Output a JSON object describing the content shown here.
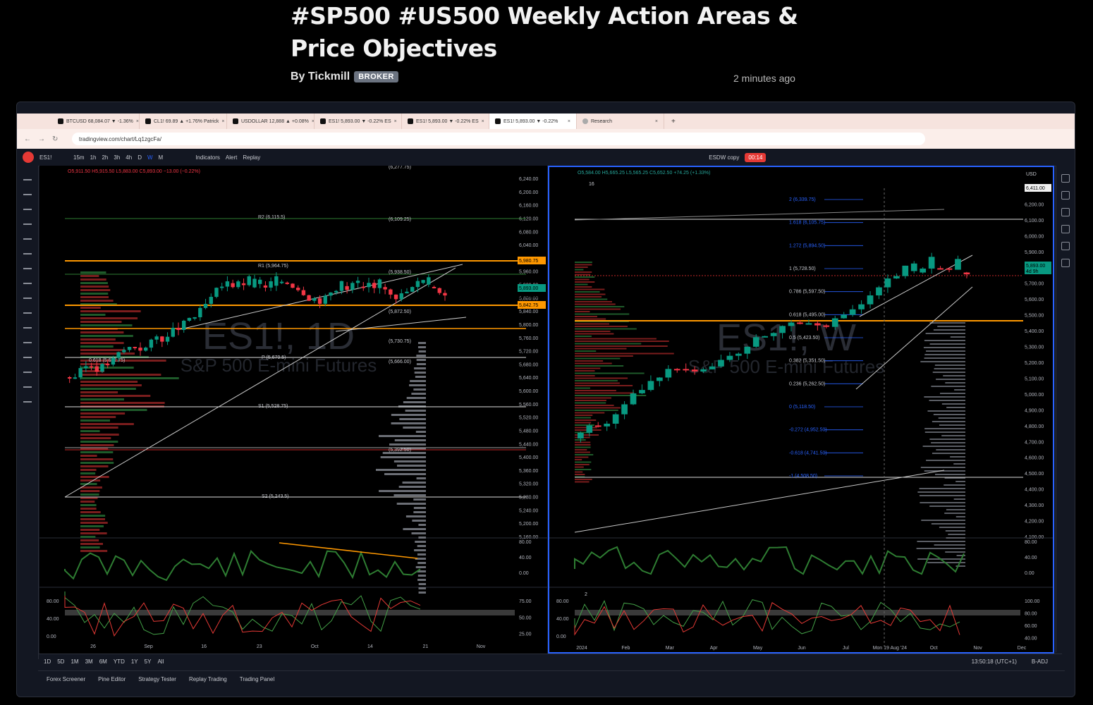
{
  "article": {
    "title": "#SP500 #US500 Weekly Action Areas & Price Objectives",
    "author": "By Tickmill",
    "badge": "BROKER",
    "time_ago": "2 minutes ago"
  },
  "browser": {
    "tabs": [
      {
        "label": "BTCUSD 68,084.07 ▼ -1.36%"
      },
      {
        "label": "CL1! 69.89 ▲ +1.76% Patrick"
      },
      {
        "label": "USDOLLAR 12,888 ▲ +0.08%"
      },
      {
        "label": "ES1! 5,893.00 ▼ -0.22% ES"
      },
      {
        "label": "ES1! 5,893.00 ▼ -0.22% ES"
      },
      {
        "label": "ES1! 5,893.00 ▼ -0.22%"
      },
      {
        "label": "Research"
      }
    ],
    "url": "tradingview.com/chart/Lq1zgcFa/"
  },
  "toolbar": {
    "symbol": "ES1!",
    "intervals": [
      "15m",
      "1h",
      "2h",
      "3h",
      "4h",
      "D",
      "W",
      "M"
    ],
    "indicators": "Indicators",
    "alert": "Alert",
    "replay": "Replay",
    "layout": "ESDW copy",
    "rec_time": "00:14"
  },
  "left_chart": {
    "ohlc": {
      "o": "O5,911.50",
      "h": "H5,915.50",
      "l": "L5,883.00",
      "c": "C5,893.00",
      "chg": "−13.00 (−0.22%)"
    },
    "watermark": "ES1!, 1D",
    "watermark_sub": "S&P 500 E-mini Futures",
    "price_ticks": [
      "6,240.00",
      "6,200.00",
      "6,160.00",
      "6,120.00",
      "6,080.00",
      "6,040.00",
      "6,000.00",
      "5,960.00",
      "5,920.00",
      "5,880.00",
      "5,840.00",
      "5,800.00",
      "5,760.00",
      "5,720.00",
      "5,680.00",
      "5,640.00",
      "5,600.00",
      "5,560.00",
      "5,520.00",
      "5,480.00",
      "5,440.00",
      "5,400.00",
      "5,360.00",
      "5,320.00",
      "5,280.00",
      "5,240.00",
      "5,200.00",
      "5,160.00"
    ],
    "time_ticks": [
      "26",
      "Sep",
      "16",
      "23",
      "Oct",
      "14",
      "21",
      "Nov"
    ],
    "labels": {
      "r2": "R2 (6,115.5)",
      "r1": "R1 (5,964.75)",
      "p": "P (5,679.5)",
      "s1": "S1 (5,528.75)",
      "s2": "S2 (5,243.5)",
      "lvl_top": "(6,277.75)",
      "lvl_6109": "(6,109.25)",
      "lvl_5938": "(5,938.50)",
      "lvl_5872": "(5,872.50)",
      "lvl_5730": "(5,730.75)",
      "lvl_5666": "(5,666.00)",
      "lvl_5392": "(5,392.50)",
      "poc": "0.618 (5,672.75)"
    },
    "price_tags": {
      "upper": "5,980.75",
      "last": "5,893.00",
      "last_time": "08:09:40",
      "lower": "5,842.75"
    },
    "rsi_ticks": [
      "80.00",
      "40.00",
      "0.00"
    ],
    "stoch_ticks": [
      "80.00",
      "40.00",
      "0.00"
    ],
    "stoch_right": [
      "75.00",
      "50.00",
      "25.00"
    ]
  },
  "right_chart": {
    "ohlc": {
      "o": "O5,584.00",
      "h": "H5,665.25",
      "l": "L5,565.25",
      "c": "C5,652.50",
      "chg": "+74.25 (+1.33%)"
    },
    "lookback": "16",
    "watermark": "ES1!, W",
    "watermark_sub": "S&P 500 E-mini Futures",
    "price_ticks": [
      "6,300.00",
      "6,200.00",
      "6,100.00",
      "6,000.00",
      "5,900.00",
      "5,800.00",
      "5,700.00",
      "5,600.00",
      "5,500.00",
      "5,400.00",
      "5,300.00",
      "5,200.00",
      "5,100.00",
      "5,000.00",
      "4,900.00",
      "4,800.00",
      "4,700.00",
      "4,600.00",
      "4,500.00",
      "4,400.00",
      "4,300.00",
      "4,200.00",
      "4,100.00"
    ],
    "time_ticks": [
      "2024",
      "Feb",
      "Mar",
      "Apr",
      "May",
      "Jun",
      "Jul",
      "Mon 19 Aug '24",
      "Oct",
      "Nov",
      "Dec"
    ],
    "fib": [
      "2 (6,339.75)",
      "1.618 (6,105.75)",
      "1.272 (5,894.50)",
      "1 (5,728.50)",
      "0.786 (5,597.50)",
      "0.618 (5,495.00)",
      "0.5 (5,423.50)",
      "0.382 (5,351.50)",
      "0.236 (5,262.50)",
      "0 (5,118.50)",
      "-0.272 (4,952.50)",
      "-0.618 (4,741.50)",
      "-1 (4,508.50)"
    ],
    "price_tags": {
      "top": "6,411.00",
      "last": "5,893.00",
      "last_time": "4d 9h"
    },
    "currency": "USD",
    "rsi_ticks": [
      "80.00",
      "40.00",
      "0.00"
    ],
    "stoch_ticks": [
      "80.00",
      "40.00",
      "0.00"
    ],
    "stoch_right": [
      "100.00",
      "80.00",
      "60.00",
      "40.00"
    ],
    "stoch_count": "2"
  },
  "bottom": {
    "ranges": [
      "1D",
      "5D",
      "1M",
      "3M",
      "6M",
      "YTD",
      "1Y",
      "5Y",
      "All"
    ],
    "clock": "13:50:18 (UTC+1)",
    "adj": "B-ADJ"
  },
  "footer": {
    "items": [
      "Forex Screener",
      "Pine Editor",
      "Strategy Tester",
      "Replay Trading",
      "Trading Panel"
    ]
  },
  "colors": {
    "up": "#089981",
    "down": "#f23645",
    "orange": "#ff9800",
    "blue": "#2962ff"
  }
}
